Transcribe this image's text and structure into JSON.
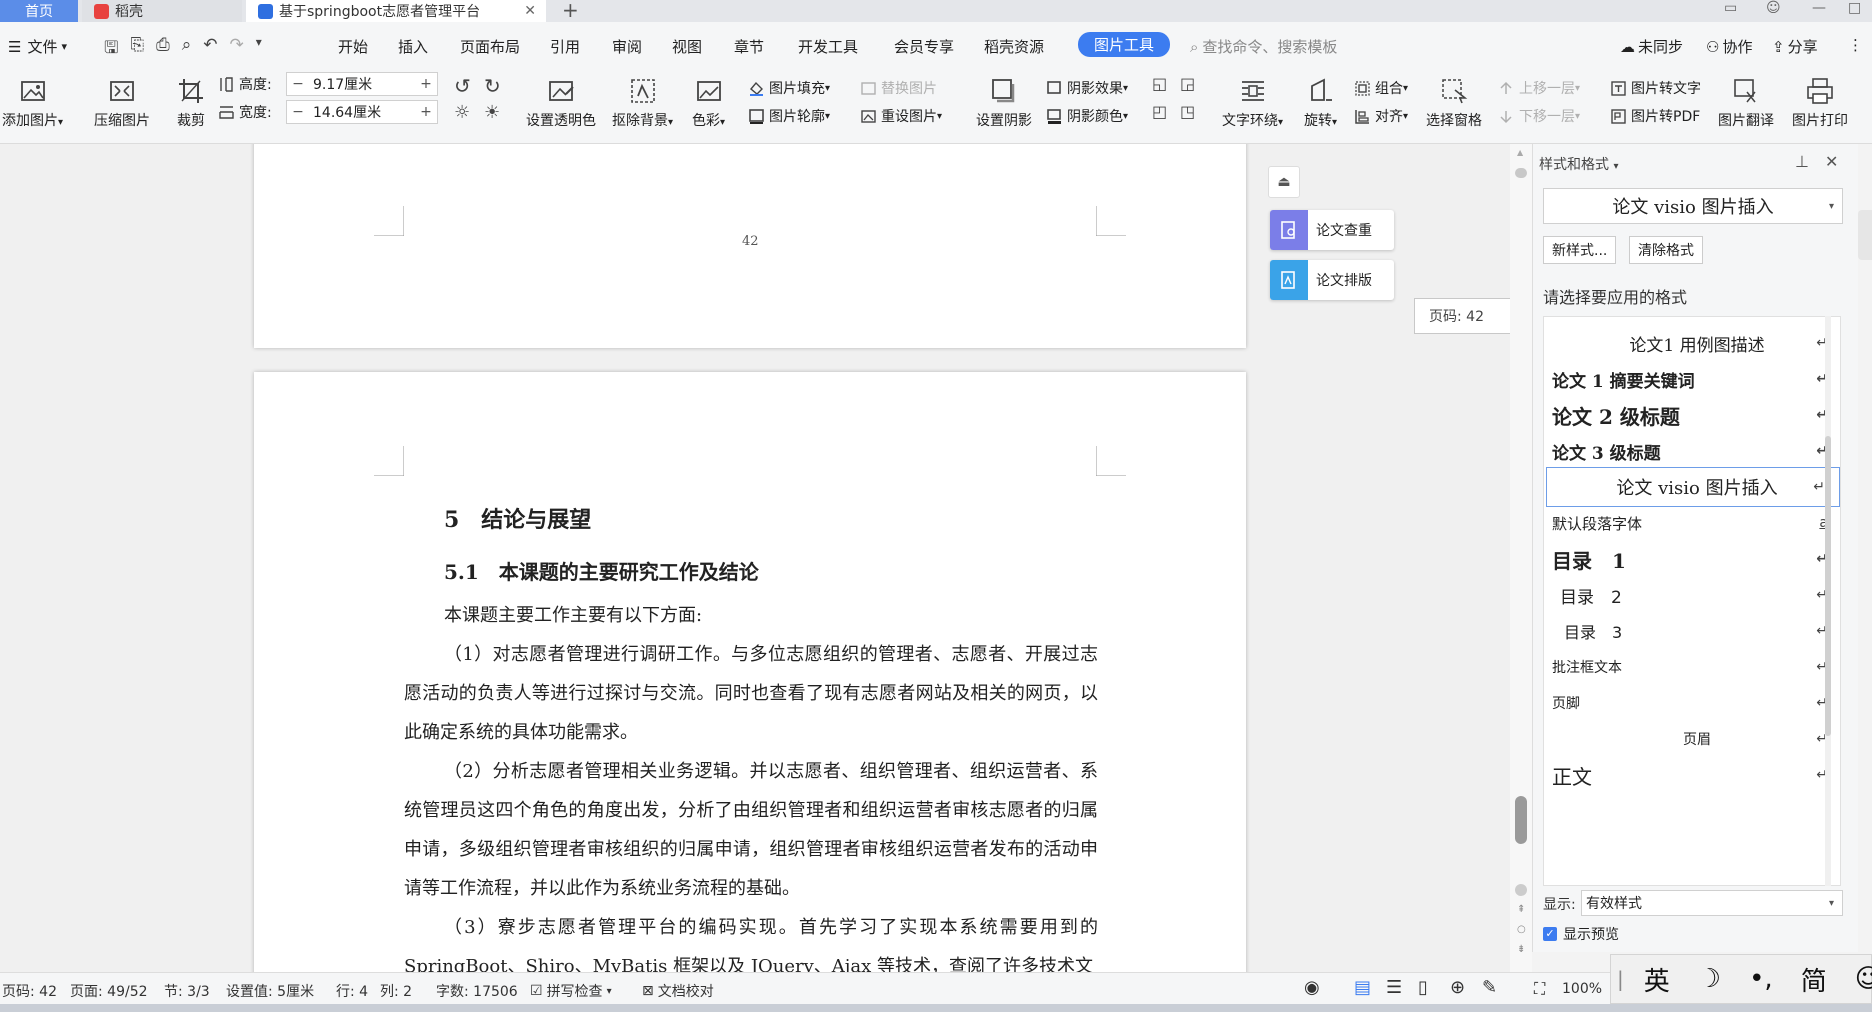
{
  "tabs": {
    "home": "首页",
    "daoke": "稻壳",
    "doc": "基于springboot志愿者管理平台"
  },
  "menu": {
    "file": "文件",
    "items": [
      "开始",
      "插入",
      "页面布局",
      "引用",
      "审阅",
      "视图",
      "章节",
      "开发工具",
      "会员专享",
      "稻壳资源"
    ],
    "active": "图片工具",
    "search_placeholder": "查找命令、搜索模板",
    "right": [
      "未同步",
      "协作",
      "分享"
    ]
  },
  "ribbon": {
    "add_image": "添加图片",
    "compress": "压缩图片",
    "crop": "裁剪",
    "height_label": "高度:",
    "height_value": "9.17厘米",
    "width_label": "宽度:",
    "width_value": "14.64厘米",
    "set_transparent": "设置透明色",
    "remove_bg": "抠除背景",
    "color": "色彩",
    "img_fill": "图片填充",
    "img_outline": "图片轮廓",
    "replace_img": "替换图片",
    "reset_img": "重设图片",
    "set_shadow": "设置阴影",
    "shadow_effect": "阴影效果",
    "shadow_color": "阴影颜色",
    "text_wrap": "文字环绕",
    "rotate": "旋转",
    "group": "组合",
    "align": "对齐",
    "select_pane": "选择窗格",
    "move_up": "上移一层",
    "move_down": "下移一层",
    "img_to_text": "图片转文字",
    "img_to_pdf": "图片转PDF",
    "img_translate": "图片翻译",
    "img_print": "图片打印"
  },
  "document": {
    "page_number": "42",
    "heading1": "5　结论与展望",
    "heading2": "5.1　本课题的主要研究工作及结论",
    "p0": "本课题主要工作主要有以下方面:",
    "p1": "（1）对志愿者管理进行调研工作。与多位志愿组织的管理者、志愿者、开展过志愿活动的负责人等进行过探讨与交流。同时也查看了现有志愿者网站及相关的网页，以此确定系统的具体功能需求。",
    "p2": "（2）分析志愿者管理相关业务逻辑。并以志愿者、组织管理者、组织运营者、系统管理员这四个角色的角度出发，分析了由组织管理者和组织运营者审核志愿者的归属申请，多级组织管理者审核组织的归属申请，组织管理者审核组织运营者发布的活动申请等工作流程，并以此作为系统业务流程的基础。",
    "p3": "（3）寮步志愿者管理平台的编码实现。首先学习了实现本系统需要用到的SpringBoot、Shiro、MyBatis 框架以及 JQuery、Ajax 等技术，查阅了许多技术文"
  },
  "float_panel": {
    "check": "论文查重",
    "layout": "论文排版",
    "page_tip": "页码: 42"
  },
  "style_panel": {
    "title": "样式和格式",
    "current_style": "论文 visio 图片插入",
    "new_style": "新样式...",
    "clear_format": "清除格式",
    "choose_label": "请选择要应用的格式",
    "styles": [
      "论文1 用例图描述",
      "论文 1 摘要关键词",
      "论文 2 级标题",
      "论文 3 级标题",
      "论文 visio 图片插入",
      "默认段落字体",
      "目录　1",
      "目录　2",
      "目录　3",
      "批注框文本",
      "页脚",
      "页眉",
      "正文"
    ],
    "show_label": "显示:",
    "show_value": "有效样式",
    "preview_label": "显示预览"
  },
  "status": {
    "page": "页码: 42",
    "pages": "页面: 49/52",
    "section": "节: 3/3",
    "setting": "设置值: 5厘米",
    "row": "行: 4",
    "col": "列: 2",
    "words": "字数: 17506",
    "spell": "拼写检查",
    "proof": "文档校对",
    "zoom": "100%"
  },
  "ime": [
    "英",
    "简"
  ],
  "colors": {
    "accent": "#3c7cf0",
    "home_tab": "#5b8de8",
    "doc_icon": "#2f6fe0",
    "daoke_icon": "#e8423f"
  }
}
